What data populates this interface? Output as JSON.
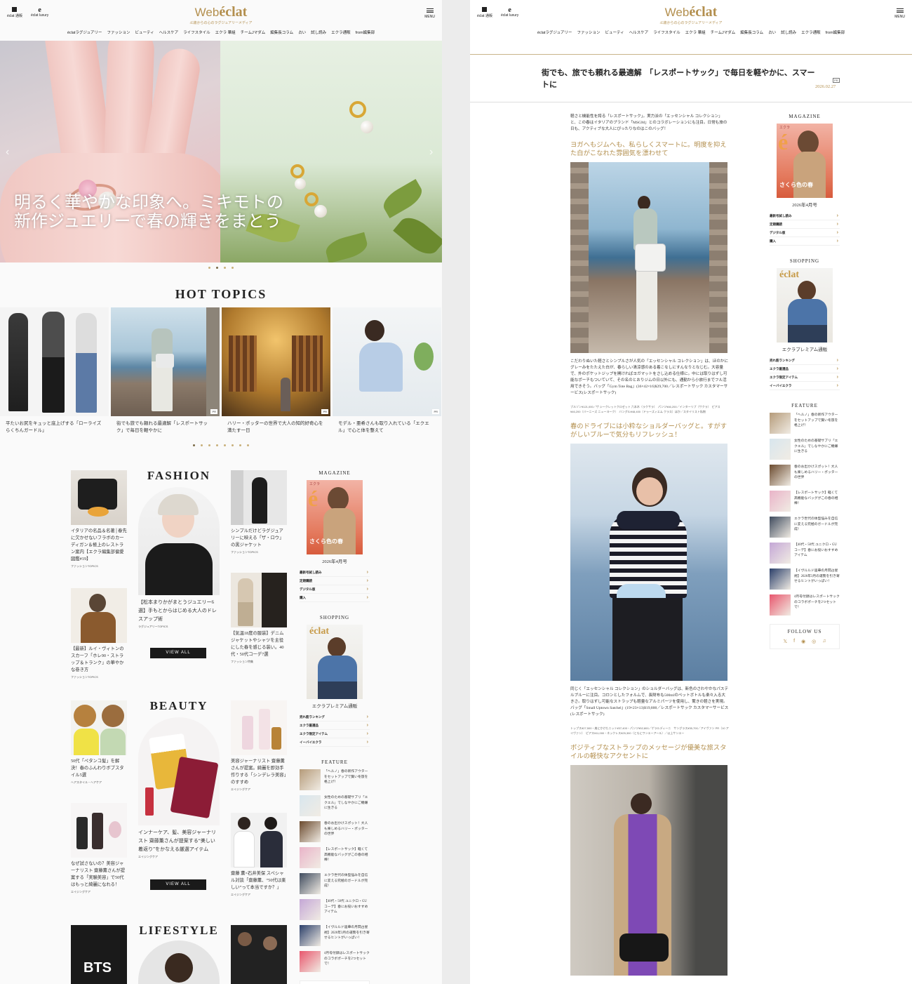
{
  "header": {
    "icon_left_1": "éclat 通販",
    "icon_left_2": "éclat luxury",
    "logo_web": "Web",
    "logo_eclat": "éclat",
    "tagline": "45歳からの心のラグジュアリーメディア",
    "menu_label": "MENU",
    "nav": [
      "éclatラグジュアリー",
      "ファッション",
      "ビューティ",
      "ヘルスケア",
      "ライフスタイル",
      "エクラ 華組",
      "チームJマダム",
      "編集長コラム",
      "占い",
      "試し読み",
      "エクラ通販",
      "from編集部"
    ]
  },
  "hero": {
    "text": "明るく華やかな印象へ。ミキモトの新作ジュエリーで春の輝きをまとう",
    "prev_arrow": "‹",
    "next_arrow": "›",
    "dots": 4,
    "active_dot": 1
  },
  "hot_topics": {
    "title": "HOT TOPICS",
    "items": [
      {
        "caption": "平たいお尻をキュッと底上げする「ローライズらくちんガードル」",
        "pr": ""
      },
      {
        "caption": "街でも旅でも頼れる最適解「レスポートサック」で毎日を軽やかに",
        "pr": "PR"
      },
      {
        "caption": "ハリー・ポッターの世界で大人の知的好奇心を満たす一日",
        "pr": "PR"
      },
      {
        "caption": "モデル・亜希さんも取り入れている「エクエル」で心と体を整えて",
        "pr": "PR"
      }
    ],
    "dots": 8,
    "active_dot": 0
  },
  "fashion": {
    "title": "FASHION",
    "view_all": "VIEW ALL",
    "cards": [
      {
        "caption": "イタリアの名品＆名著│春先に欠かせないフラボのカーディガン＆極上のレストラン案内【エクラ編集部偏愛図鑑#19】",
        "category": "ファッションTOPICS"
      },
      {
        "caption": "【最新】ルイ・ヴィトンのスカーフ「ホレ90・ストラップ＆トランク」の華やかな巻き方",
        "category": "ファッションTOPICS"
      },
      {
        "caption": "【松本まりかがまとうジュエリー6選】手もとからはじめる大人のドレスアップ術",
        "category": "ラグジュアリーTOPICS"
      },
      {
        "caption": "シンプルだけどラグジュアリーに映える「ザ・ロウ」の黒ジャケット",
        "category": "ファッションTOPICS"
      },
      {
        "caption": "【気温18度の服装】デニムジャケットやシャツを主役にした春を感じる装い。40代・50代コーデ7選",
        "category": "ファッション特集"
      }
    ]
  },
  "beauty": {
    "title": "BEAUTY",
    "view_all": "VIEW ALL",
    "cards": [
      {
        "caption": "50代「ペタンコ髪」を解決！春のふんわりボブスタイル5選",
        "category": "ヘアスタイル・ヘアケア"
      },
      {
        "caption": "なぜ試さないの？美容ジャーナリスト 齋藤薫さんが提案する「実験美容」で50代はもっと綺麗になれる！",
        "category": "エイジングケア"
      },
      {
        "caption": "インナーケア、髪、美容ジャーナリスト 齋藤薫さんが提案する“美しい着返り”をかなえる厳選アイテム",
        "category": "エイジングケア"
      },
      {
        "caption": "美容ジャーナリスト 齋藤薫さんが提案。綺麗を即効手作りする「シンデレラ美容」のすすめ",
        "category": "エイジングケア"
      },
      {
        "caption": "齋藤 薫×石井美保 スペシャル対談「齋藤薫、“50代は楽しい”って本当ですか？」",
        "category": "エイジングケア"
      }
    ]
  },
  "lifestyle": {
    "title": "LIFESTYLE",
    "bts_text": "BTS"
  },
  "sidebar": {
    "magazine_title": "MAGAZINE",
    "issue": "2026年4月号",
    "magazine_cover_name": "エクラ",
    "magazine_cover_headline": "さくら色の春",
    "magazine_links": [
      "最新号試し読み",
      "定期購読",
      "デジタル版",
      "購入"
    ],
    "shopping_title": "SHOPPING",
    "shopping_caption": "エクラプレミアム通販",
    "shopping_cover_name": "éclat",
    "shopping_links": [
      "売れ筋ランキング",
      "エクラ厳選品",
      "エクラ限定アイテム",
      "イーバイエクラ"
    ],
    "feature_title": "FEATURE",
    "features": [
      "「ヘルノ」春の新作アウターをセットアップで賢い冬旅を格上げ！",
      "女性のための基礎サプリ「エクエル」でしなやかにご機嫌に生きる",
      "春のお出かけスポット！大人も楽しめるハリー・ポッターの世界",
      "【レスポートサック】軽くて高機能なバッグがこの春の相棒！",
      "エクラ世代の体型悩みを自信に変える究極のガードルが完成！",
      "【40代・50代 ユニクロ・GU コーデ】春にお役いおすすめアイテム",
      "【イヴルルド遥華の月間占星術】2026年3月の運勢を引き寄せるヒントがいっぱい！",
      "4月号付録はレスポートサックのコラボポーチを2つセットで！"
    ],
    "follow_title": "FOLLOW US",
    "social_icons": [
      "x-icon",
      "facebook-icon",
      "line-icon",
      "instagram-icon",
      "bell-icon"
    ],
    "social_glyphs": [
      "𝕏",
      "f",
      "◉",
      "◎",
      "♫"
    ]
  },
  "article": {
    "title": "街でも、旅でも頼れる最適解　「レスポートサック」で毎日を軽やかに、スマートに",
    "badge": "PR",
    "date": "2026.02.27",
    "intro": "軽さと機能性を誇る「レスポートサック」。実力派の「エッセンシャル コレクション」と、この春はイタリアのブランド「MSGM」とのコラボレーションにも注目。日常も旅の日も、アクティブな大人にぴったりなのはこのバッグ！",
    "h1": "ヨガへもジムへも、私らしくスマートに。明度を抑えた白がこなれた雰囲気を漂わせて",
    "p1": "こだわりぬいた軽さとシンプルさが人気の「エッセンシャル コレクション」は、ほのかにグレーみをたたえた白が、春らしい清涼感のある着こなしにすんなりとなじむ。大容量で、外のポケットジップを開ければヨガマットをさし込める仕様に。中には取りはずし可能なポーチもついていて、その名のとおりジムの日以外にも、通勤から小旅行までフル活用できそう。バッグ「Gym Tote Bag」(36×42×16)¥29,700／レスポートサック カスタマーサービス(レスポートサック)",
    "credit1": "ブルゾン¥121,000／ザ シークレットクロゼット 六本木（ラクサラ）　パンツ¥46,200／インターリブ（サクラ）　ピアス¥46,200（バーニーズ ニューヨーク）　バングル¥48,400（ドゥーズィエム クラス）ほか／スタイリスト私物",
    "h2": "春のドライブには小粋なショルダーバッグと。すがすがしいブルーで気分もリフレッシュ！",
    "p2": "同じく「エッセンシャル コレクション」のショルダーバッグは、新色のさわやかなパステルブルーに注目。コロンとしたフォルムで、長財布も500mlのペットボトルも楽々入る大きさ。取りはずし可能なストラップも軽量なアルミパーツを使用し、驚きの軽さを実現。バッグ「Small Uptown Satchel」(19×23×13)¥19,800／レスポートサック カスタマーサービス(レスポートサック)",
    "credit2": "トップス¥27,500・肩にかけたニット¥37,400・パンツ¥52,800／ゲラルディーニ　サングラス¥35,700／アイヴァン PR（10 アイヴァン）　ピアス¥11,000・ネックレス¥25,300（ともにワンエーアール）／以上サンエー",
    "h3": "ポジティブなストラップのメッセージが優美な旅スタイルの軽快なアクセントに"
  }
}
